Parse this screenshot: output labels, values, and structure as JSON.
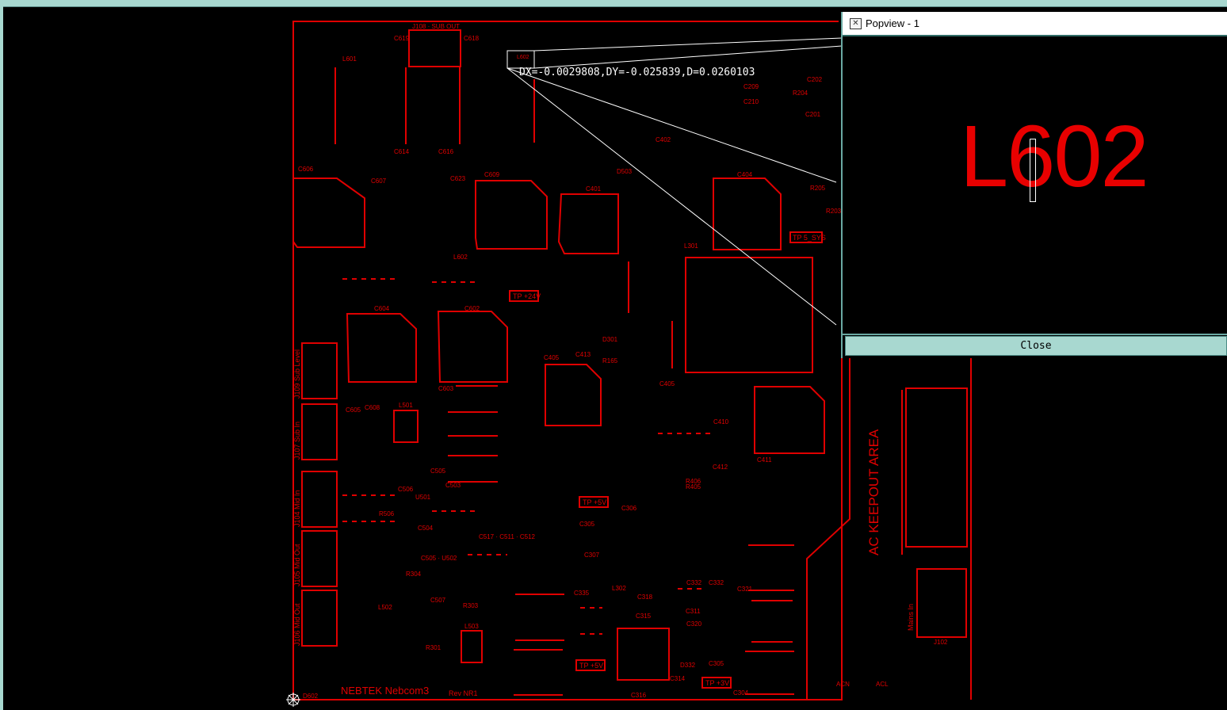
{
  "popview": {
    "title": "Popview - 1",
    "zoom_text": "L602",
    "close_label": "Close"
  },
  "measure": {
    "text": "DX=-0.0029808,DY=-0.025839,D=0.0260103"
  },
  "board": {
    "name": "NEBTEK Nebcom3",
    "revision": "Rev NR1",
    "keepout_text": "AC KEEPOUT AREA",
    "connector_labels": [
      "J109 Sub Level",
      "J107 Sub In",
      "J104 Mid In",
      "J105 Mid Out",
      "J106 Mid Out",
      "Mains In"
    ],
    "testpoints": [
      "TP +24V",
      "TP +5V",
      "TP +5V",
      "TP +3V",
      "TP 5_SYS"
    ],
    "refdes": [
      "J108",
      "SUB OUT",
      "C619",
      "C618",
      "L601",
      "C614",
      "C616",
      "C612",
      "C617",
      "C606",
      "C607",
      "C609",
      "C623",
      "C613",
      "C603",
      "C608",
      "L602",
      "C605",
      "C401",
      "D503",
      "C402",
      "L301",
      "R165",
      "C413",
      "C602",
      "C604",
      "C501",
      "C502",
      "C504",
      "C505",
      "C507",
      "C506",
      "C517",
      "C511",
      "C512",
      "R304",
      "R501",
      "R502",
      "L501",
      "D501",
      "D502",
      "C306",
      "C307",
      "C318",
      "C319",
      "C321",
      "C322",
      "C325",
      "C332",
      "C335",
      "D332",
      "U302",
      "D301",
      "R301",
      "R302",
      "C201",
      "C202",
      "C203",
      "C205",
      "C206",
      "C209",
      "C210",
      "R201",
      "R202",
      "R204",
      "C101",
      "C104",
      "C107",
      "C110",
      "R105",
      "R106",
      "R110",
      "J102",
      "R102",
      "C301",
      "L201",
      "C404",
      "C405",
      "L302",
      "ACN",
      "ACL"
    ],
    "selected_component": "L602"
  }
}
